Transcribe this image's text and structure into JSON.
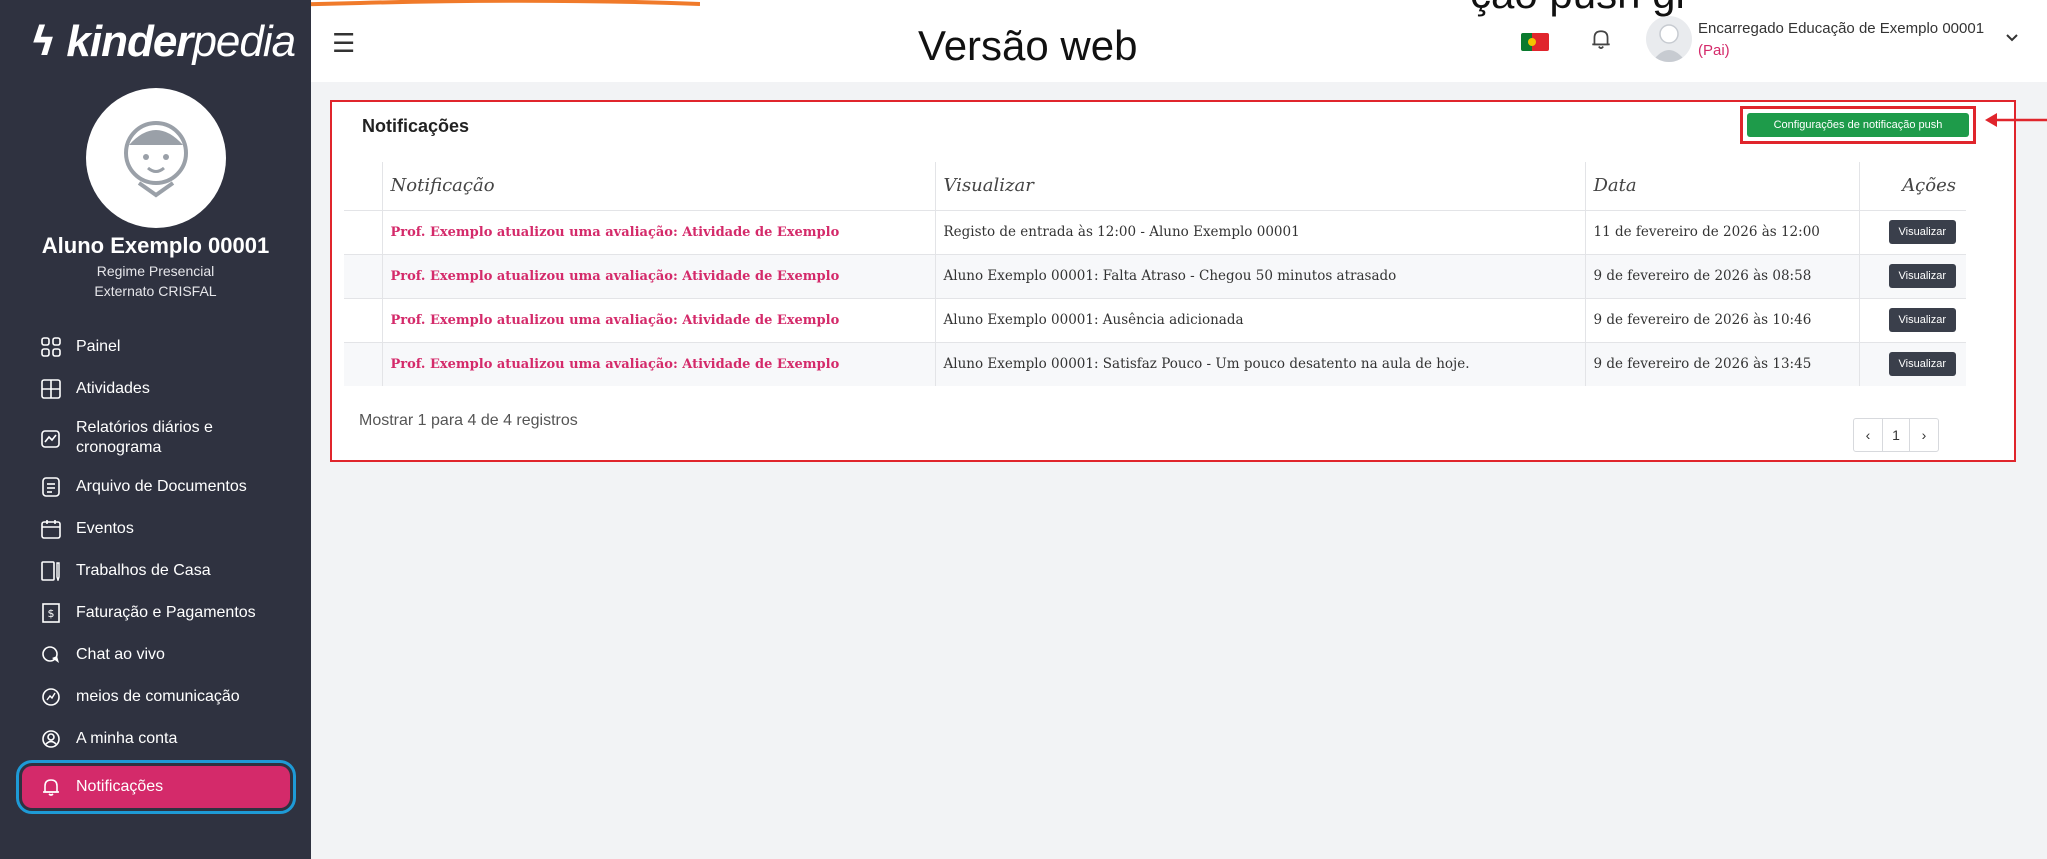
{
  "app": {
    "logo_text_bold": "kinder",
    "logo_text_rest": "pedia",
    "heading": "Versão web",
    "cut_heading": "ção push gi"
  },
  "student": {
    "name": "Aluno Exemplo 00001",
    "regime": "Regime Presencial",
    "school": "Externato CRISFAL"
  },
  "sidebar": {
    "items": [
      {
        "label": "Painel",
        "icon": "dashboard-icon"
      },
      {
        "label": "Atividades",
        "icon": "activities-icon"
      },
      {
        "label": "Relatórios diários e cronograma",
        "icon": "report-chart-icon"
      },
      {
        "label": "Arquivo de Documentos",
        "icon": "document-icon"
      },
      {
        "label": "Eventos",
        "icon": "calendar-icon"
      },
      {
        "label": "Trabalhos de Casa",
        "icon": "homework-icon"
      },
      {
        "label": "Faturação e Pagamentos",
        "icon": "invoice-icon"
      },
      {
        "label": "Chat ao vivo",
        "icon": "chat-icon"
      },
      {
        "label": "meios de comunicação",
        "icon": "media-icon"
      },
      {
        "label": "A minha conta",
        "icon": "account-icon"
      },
      {
        "label": "Notificações",
        "icon": "bell-icon"
      }
    ]
  },
  "user": {
    "name": "Encarregado Educação de Exemplo 00001",
    "role": "(Pai)"
  },
  "panel": {
    "title": "Notificações",
    "push_button": "Configurações de notificação push",
    "columns": [
      "Notificação",
      "Visualizar",
      "Data",
      "Ações"
    ],
    "rows": [
      {
        "notification": "Prof. Exemplo atualizou uma avaliação: Atividade de Exemplo",
        "view": "Registo de entrada às 12:00  -  Aluno Exemplo 00001",
        "date": "11 de fevereiro de 2026 às 12:00",
        "action": "Visualizar"
      },
      {
        "notification": "Prof. Exemplo atualizou uma avaliação: Atividade de Exemplo",
        "view": "Aluno Exemplo 00001: Falta Atraso - Chegou 50 minutos atrasado",
        "date": "9 de fevereiro de 2026 às 08:58",
        "action": "Visualizar"
      },
      {
        "notification": "Prof. Exemplo atualizou uma avaliação: Atividade de Exemplo",
        "view": "Aluno Exemplo 00001: Ausência adicionada",
        "date": "9 de fevereiro de 2026 às 10:46",
        "action": "Visualizar"
      },
      {
        "notification": "Prof. Exemplo atualizou uma avaliação: Atividade de Exemplo",
        "view": "Aluno Exemplo 00001: Satisfaz Pouco - Um pouco desatento na aula de hoje.",
        "date": "9 de fevereiro de 2026 às 13:45",
        "action": "Visualizar"
      }
    ],
    "footer": "Mostrar 1 para 4 de 4 registros",
    "pager": {
      "prev": "‹",
      "page": "1",
      "next": "›"
    }
  },
  "colors": {
    "sidebar_bg": "#2f3240",
    "accent_pink": "#d42a6a",
    "highlight_red": "#e0252c",
    "green_button": "#1e9b4a",
    "active_outline": "#1e9ad6"
  }
}
